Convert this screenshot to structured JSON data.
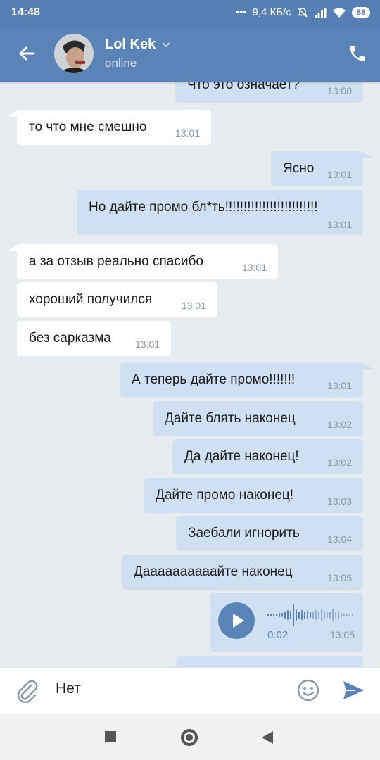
{
  "status": {
    "time": "14:48",
    "speed": "9,4 КБ/с",
    "battery": "88"
  },
  "contact": {
    "name": "Lol Kek",
    "status": "online"
  },
  "messages": [
    {
      "text": "Что это означает?",
      "time": "13:00"
    },
    {
      "text": "то что мне смешно",
      "time": "13:01"
    },
    {
      "text": "Ясно",
      "time": "13:01"
    },
    {
      "text": "Но дайте промо бл*ть!!!!!!!!!!!!!!!!!!!!!!!!!",
      "time": "13:01"
    },
    {
      "text": "а за отзыв реально спасибо",
      "time": "13:01"
    },
    {
      "text": "хороший получился",
      "time": "13:01"
    },
    {
      "text": "без сарказма",
      "time": "13:01"
    },
    {
      "text": "А теперь дайте промо!!!!!!!",
      "time": "13:01"
    },
    {
      "text": "Дайте блять наконец",
      "time": "13:02"
    },
    {
      "text": "Да дайте наконец!",
      "time": "13:02"
    },
    {
      "text": "Дайте промо наконец!",
      "time": "13:03"
    },
    {
      "text": "Заебали игнорить",
      "time": "13:04"
    },
    {
      "text": "Даааааааааайте наконец",
      "time": "13:05"
    }
  ],
  "voice": {
    "duration": "0:02",
    "time": "13:05"
  },
  "composer": {
    "value": "Нет"
  },
  "colors": {
    "header": "#5a84b8",
    "outgoing": "#cfe0f2",
    "incoming": "#ffffff",
    "background": "#e7ecf1"
  }
}
